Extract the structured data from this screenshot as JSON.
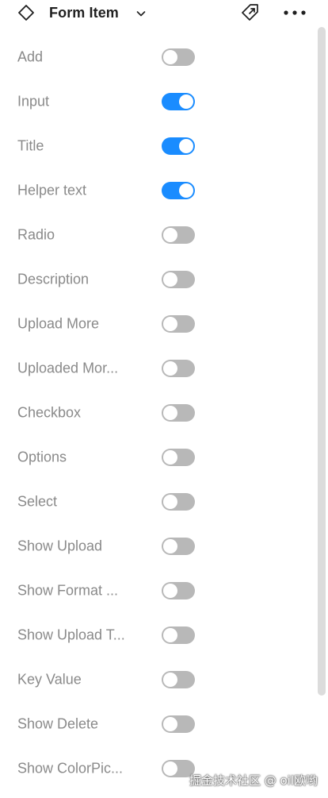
{
  "header": {
    "title": "Form Item",
    "component_icon": "component-instance-icon",
    "dropdown_icon": "chevron-down-icon",
    "detach_icon": "detach-instance-icon",
    "more_icon": "more-horizontal-icon"
  },
  "properties": [
    {
      "label": "Add",
      "enabled": false
    },
    {
      "label": "Input",
      "enabled": true
    },
    {
      "label": "Title",
      "enabled": true
    },
    {
      "label": "Helper text",
      "enabled": true
    },
    {
      "label": "Radio",
      "enabled": false
    },
    {
      "label": "Description",
      "enabled": false
    },
    {
      "label": "Upload More",
      "enabled": false
    },
    {
      "label": "Uploaded Mor...",
      "enabled": false
    },
    {
      "label": "Checkbox",
      "enabled": false
    },
    {
      "label": "Options",
      "enabled": false
    },
    {
      "label": "Select",
      "enabled": false
    },
    {
      "label": "Show Upload",
      "enabled": false
    },
    {
      "label": "Show Format ...",
      "enabled": false
    },
    {
      "label": "Show Upload T...",
      "enabled": false
    },
    {
      "label": "Key Value",
      "enabled": false
    },
    {
      "label": "Show Delete",
      "enabled": false
    },
    {
      "label": "Show ColorPic...",
      "enabled": false
    }
  ],
  "colors": {
    "toggle_on": "#1a8cff",
    "toggle_off": "#b8b8b8",
    "label": "#8a8a8a"
  },
  "watermark": "掘金技术社区 @ oil欧哟"
}
